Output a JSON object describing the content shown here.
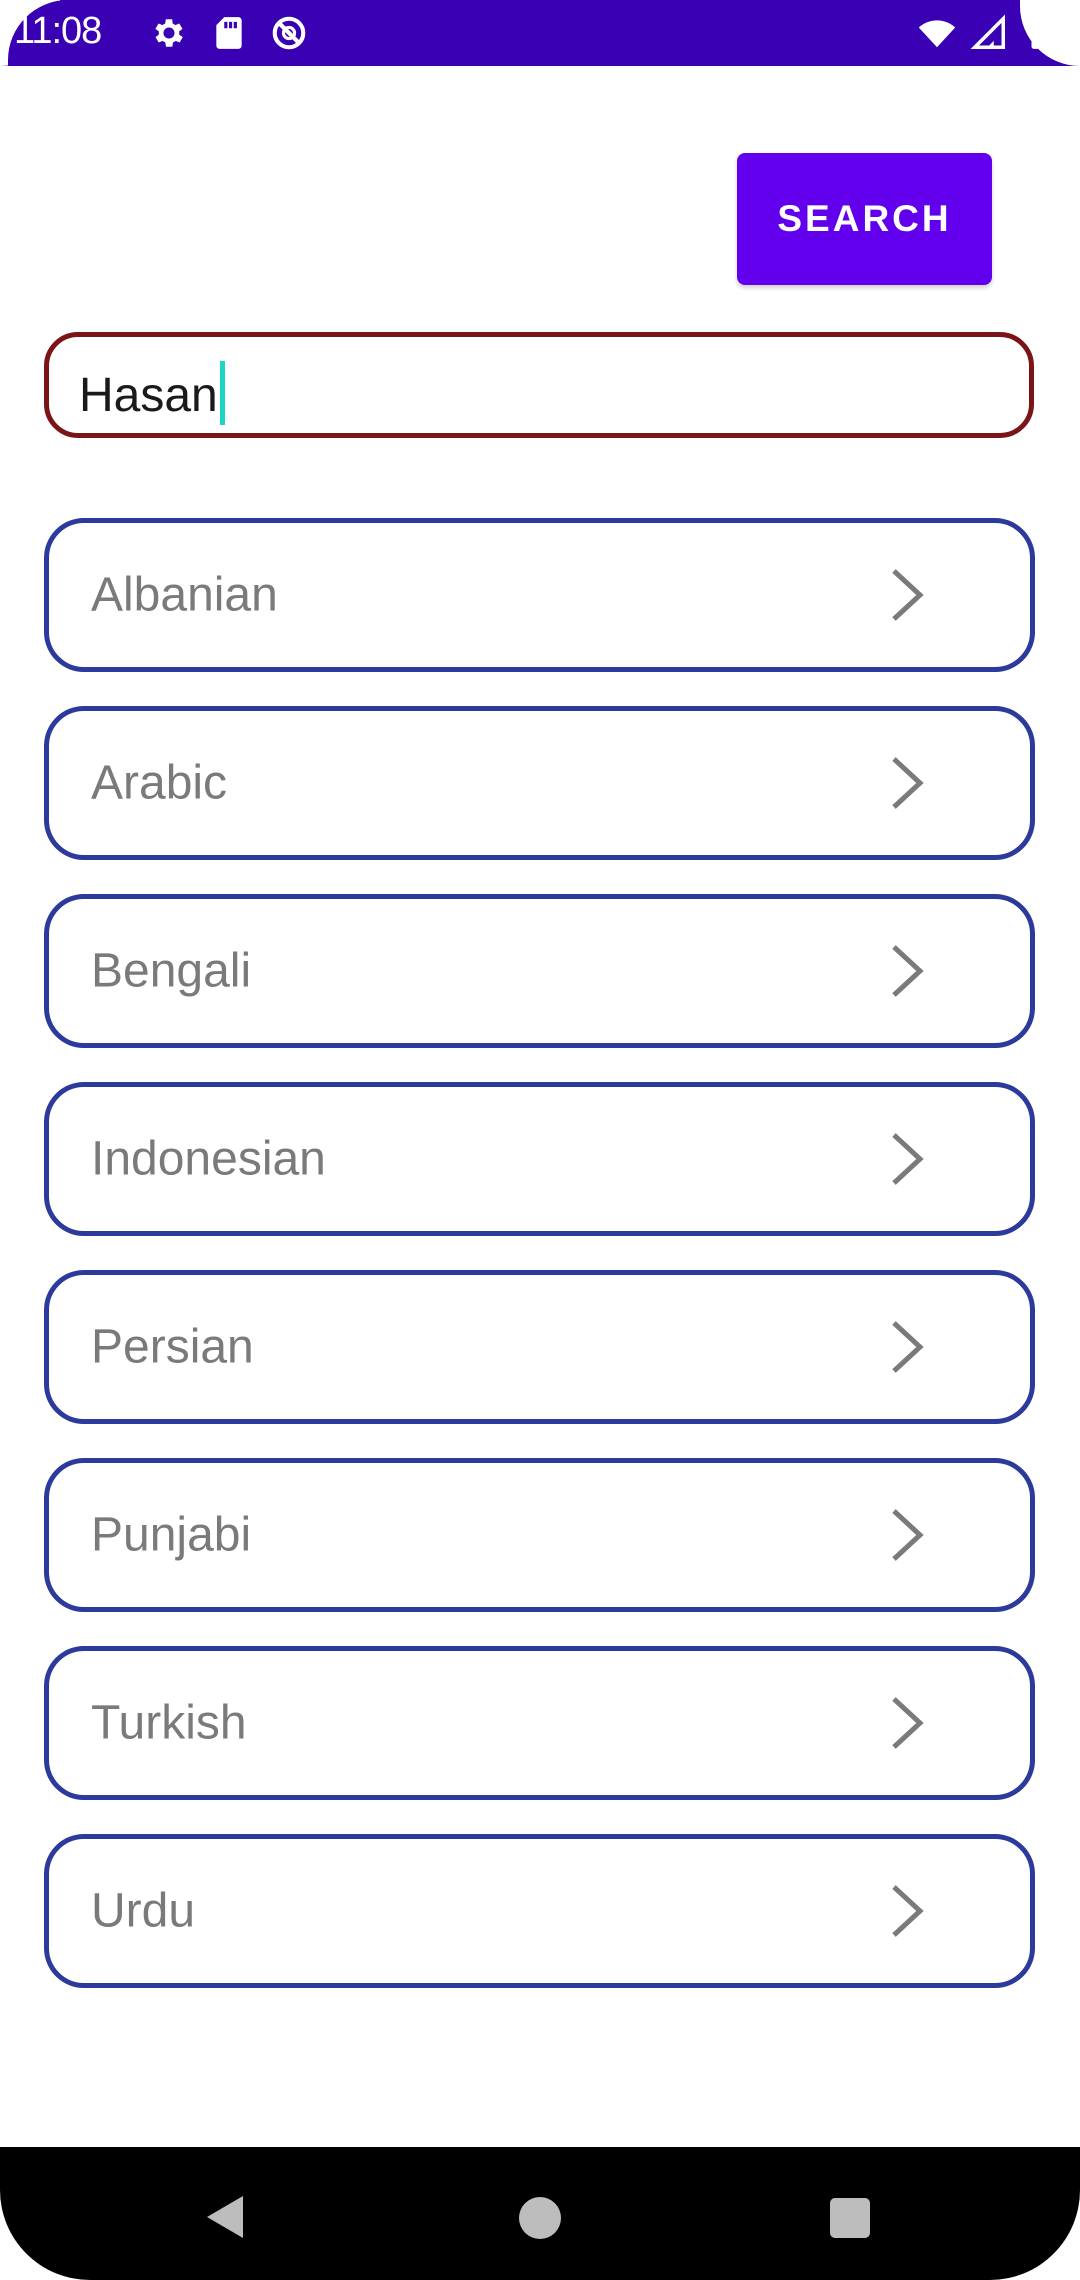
{
  "status_bar": {
    "time": "11:08",
    "left_icons": [
      "settings-icon",
      "sd-card-icon",
      "do-not-disturb-icon"
    ],
    "right_icons": [
      "wifi-icon",
      "cellular-signal-icon",
      "battery-icon"
    ],
    "background_color": "#3a00b3"
  },
  "search_button": {
    "label": "SEARCH",
    "color": "#6200ee"
  },
  "search_field": {
    "value": "Hasan",
    "border_color": "#7a1418",
    "cursor_color": "#1fd3c4"
  },
  "languages": [
    {
      "label": "Albanian",
      "icon": "chevron-right-icon"
    },
    {
      "label": "Arabic",
      "icon": "chevron-right-icon"
    },
    {
      "label": "Bengali",
      "icon": "chevron-right-icon"
    },
    {
      "label": "Indonesian",
      "icon": "chevron-right-icon"
    },
    {
      "label": "Persian",
      "icon": "chevron-right-icon"
    },
    {
      "label": "Punjabi",
      "icon": "chevron-right-icon"
    },
    {
      "label": "Turkish",
      "icon": "chevron-right-icon"
    },
    {
      "label": "Urdu",
      "icon": "chevron-right-icon"
    }
  ],
  "list_border_color": "#2c3a9c",
  "nav_bar": {
    "buttons": [
      "back-icon",
      "home-icon",
      "recents-icon"
    ]
  }
}
